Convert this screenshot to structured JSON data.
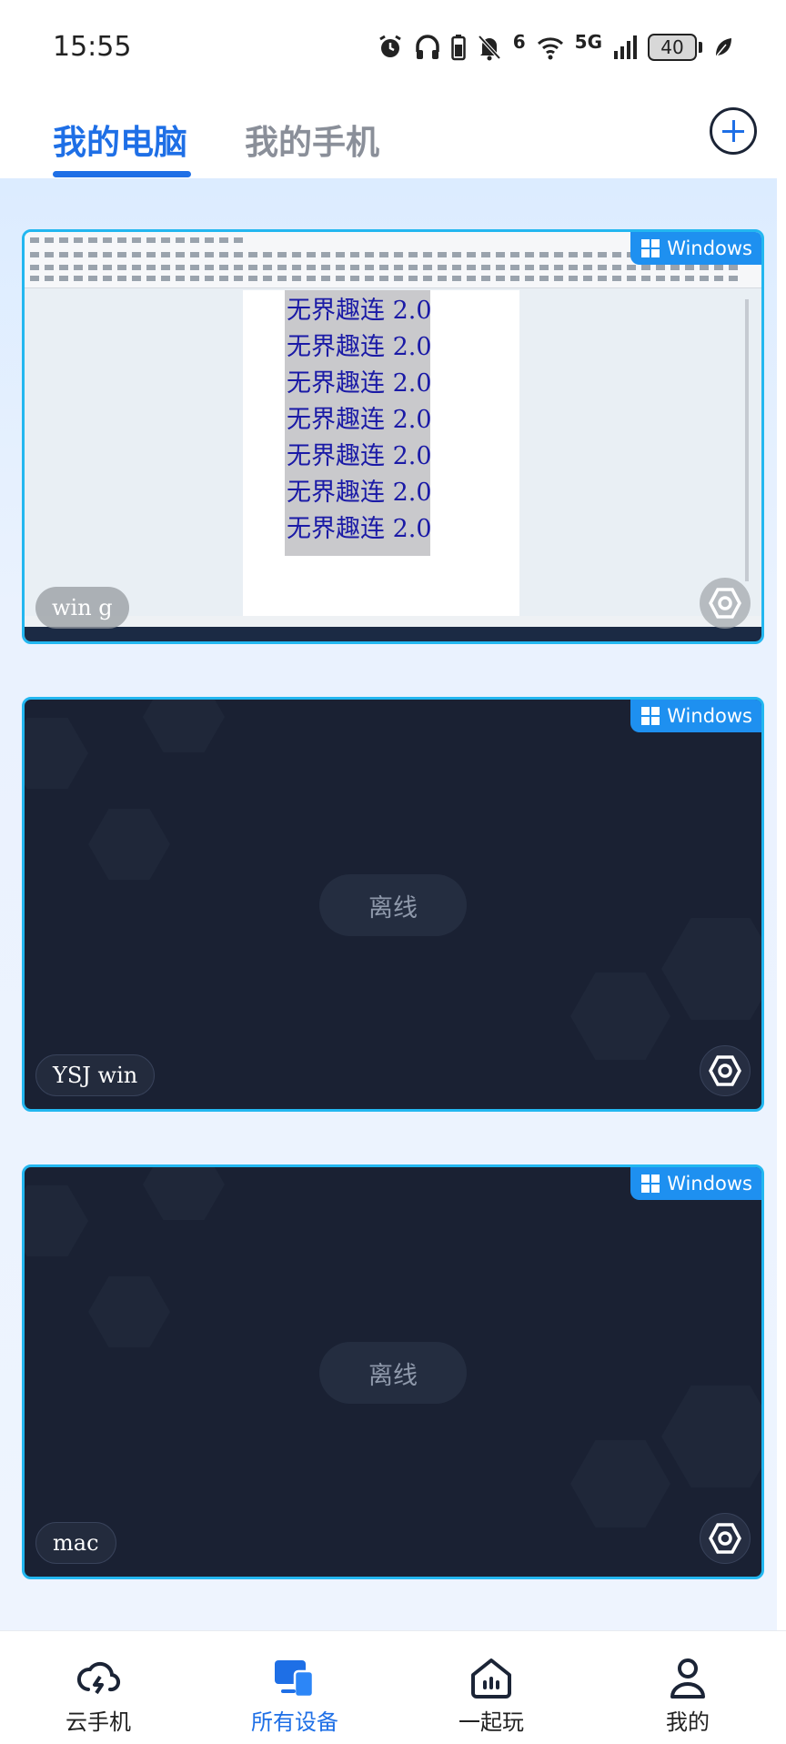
{
  "status_bar": {
    "time": "15:55",
    "signal_wifi_sup": "6",
    "signal_cell_label": "5G",
    "battery": "40"
  },
  "header": {
    "tabs": [
      {
        "label": "我的电脑",
        "active": true
      },
      {
        "label": "我的手机",
        "active": false
      }
    ],
    "add_icon": "plus-circle-icon"
  },
  "devices": [
    {
      "name": "win g",
      "os": "Windows",
      "status": "online",
      "preview_lines": [
        "无界趣连 2.0",
        "无界趣连 2.0",
        "无界趣连 2.0",
        "无界趣连 2.0",
        "无界趣连 2.0",
        "无界趣连 2.0",
        "无界趣连 2.0"
      ]
    },
    {
      "name": "YSJ win",
      "os": "Windows",
      "status_label": "离线"
    },
    {
      "name": "mac",
      "os": "Windows",
      "status_label": "离线"
    }
  ],
  "bottom_nav": [
    {
      "label": "云手机",
      "icon": "cloud-lightning-icon",
      "active": false
    },
    {
      "label": "所有设备",
      "icon": "devices-icon",
      "active": true
    },
    {
      "label": "一起玩",
      "icon": "home-chart-icon",
      "active": false
    },
    {
      "label": "我的",
      "icon": "user-icon",
      "active": false
    }
  ],
  "colors": {
    "accent": "#1e6fe6",
    "card_border": "#23b7f0",
    "badge": "#1e90f0",
    "offline_card": "#1a2133"
  }
}
